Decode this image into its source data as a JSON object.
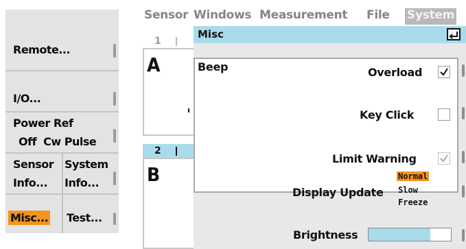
{
  "softkeys": {
    "remote": "Remote...",
    "io": "I/O...",
    "power_ref": {
      "title": "Power Ref",
      "options": "Off  Cw Pulse"
    },
    "sensor_info": {
      "line1": "Sensor",
      "line2": "Info..."
    },
    "system_info": {
      "line1": "System",
      "line2": "Info..."
    },
    "misc": "Misc...",
    "test": "Test..."
  },
  "menubar": {
    "items": [
      "Sensor",
      "Windows",
      "Measurement",
      "File",
      "System"
    ],
    "active": "System"
  },
  "windows": [
    {
      "number": "1",
      "letter": "A",
      "active": false
    },
    {
      "number": "2",
      "letter": "B",
      "active": true
    }
  ],
  "dialog": {
    "title": "Misc",
    "beep": {
      "label": "Beep",
      "overload": {
        "label": "Overload",
        "checked": true
      },
      "key_click": {
        "label": "Key Click",
        "checked": false
      },
      "limit_warning": {
        "label": "Limit Warning",
        "checked": true,
        "enabled": false
      }
    },
    "display_update": {
      "label": "Display Update",
      "options": [
        "Normal",
        "Slow",
        "Freeze"
      ],
      "selected": "Normal"
    },
    "brightness": {
      "label": "Brightness",
      "level": 0.75
    }
  },
  "colors": {
    "highlight": "#f3941c",
    "title_bar": "#a9dbeb",
    "active_tab": "#a9dbeb",
    "menu_text": "#858585"
  }
}
